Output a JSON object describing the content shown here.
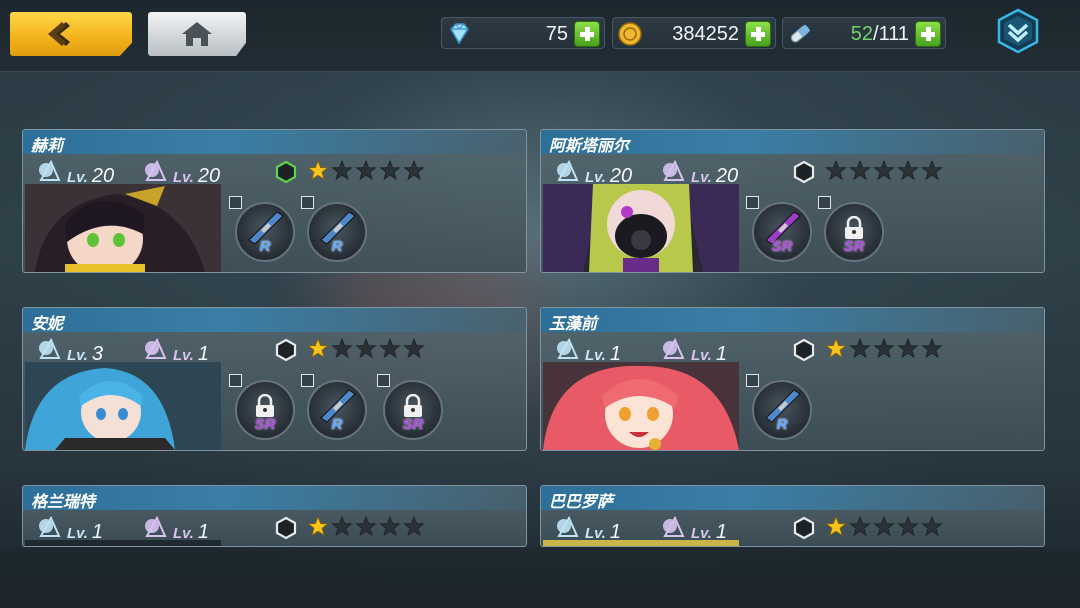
{
  "resources": {
    "diamonds": "75",
    "gold": "384252",
    "stamina_current": "52",
    "stamina_separator": "/",
    "stamina_max": "111"
  },
  "icons": {
    "back": "back-chevron-icon",
    "home": "home-icon",
    "diamond": "diamond-icon",
    "gold": "gold-coin-icon",
    "stamina": "capsule-icon",
    "plus": "plus-icon",
    "menu": "chevron-down-menu-icon"
  },
  "level_tag": "Lv.",
  "colors": {
    "accent_yellow": "#f2b21a",
    "plus_green": "#5cbf2a",
    "star_gold": "#f7c31c",
    "rarity_r": "#5aa8ff",
    "rarity_sr": "#a84fd4",
    "header_blue": "#2d6f98"
  },
  "characters": [
    {
      "name": "赫莉",
      "level_a": "20",
      "level_b": "20",
      "hex_active": true,
      "stars_filled": 1,
      "weapons": [
        {
          "rarity": "R",
          "locked": false
        },
        {
          "rarity": "R",
          "locked": false
        }
      ]
    },
    {
      "name": "阿斯塔丽尔",
      "level_a": "20",
      "level_b": "20",
      "hex_active": false,
      "stars_filled": 0,
      "weapons": [
        {
          "rarity": "SR",
          "locked": false
        },
        {
          "rarity": "SR",
          "locked": true
        }
      ]
    },
    {
      "name": "安妮",
      "level_a": "3",
      "level_b": "1",
      "hex_active": false,
      "stars_filled": 1,
      "weapons": [
        {
          "rarity": "SR",
          "locked": true
        },
        {
          "rarity": "R",
          "locked": false
        },
        {
          "rarity": "SR",
          "locked": true
        }
      ]
    },
    {
      "name": "玉藻前",
      "level_a": "1",
      "level_b": "1",
      "hex_active": false,
      "stars_filled": 1,
      "weapons": [
        {
          "rarity": "R",
          "locked": false
        }
      ]
    },
    {
      "name": "格兰瑞特",
      "level_a": "1",
      "level_b": "1",
      "hex_active": false,
      "stars_filled": 1,
      "weapons": []
    },
    {
      "name": "巴巴罗萨",
      "level_a": "1",
      "level_b": "1",
      "hex_active": false,
      "stars_filled": 1,
      "weapons": []
    }
  ]
}
